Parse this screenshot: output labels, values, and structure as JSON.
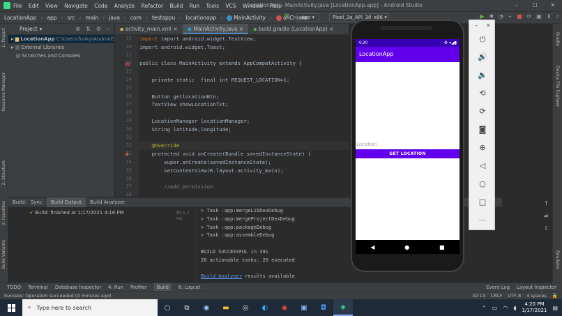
{
  "window": {
    "menu": [
      "File",
      "Edit",
      "View",
      "Navigate",
      "Code",
      "Analyze",
      "Refactor",
      "Build",
      "Run",
      "Tools",
      "VCS",
      "Window",
      "Help"
    ],
    "title": "LocationApp - MainActivity.java [LocationApp.app] - Android Studio"
  },
  "nav": {
    "crumbs": [
      "LocationApp",
      "app",
      "src",
      "main",
      "java",
      "com",
      "testappu",
      "locationapp",
      "MainActivity",
      "onCreate"
    ],
    "run_config": "app",
    "device": "Pixel_3a_API_30_x86"
  },
  "project": {
    "header": "Project",
    "tree": [
      {
        "label": "LocationApp",
        "path": "C:\\Users\\funky\\AndroidS"
      },
      {
        "label": "External Libraries",
        "path": ""
      },
      {
        "label": "Scratches and Consoles",
        "path": ""
      }
    ]
  },
  "left_stripe": {
    "project": "1: Project",
    "resource": "Resource Manager",
    "structure": "2: Structure",
    "favorites": "2: Favorites",
    "variants": "Build Variants"
  },
  "right_stripe": {
    "gradle": "Gradle",
    "explorer": "Device File Explorer",
    "emulator": "Emulator"
  },
  "editor": {
    "tabs": [
      "activity_main.xml",
      "MainActivity.java",
      "build.gradle (LocationApp)"
    ],
    "line_numbers": [
      "19",
      "20",
      "21",
      "22",
      "23",
      "24",
      "25",
      "26",
      "27",
      "28",
      "29",
      "30",
      "31",
      "32",
      "33",
      "34",
      "35",
      "36",
      "37",
      "38"
    ],
    "lines": [
      "import android.widget.TextView;",
      "import android.widget.Toast;",
      "",
      "public class MainActivity extends AppCompatActivity {",
      "",
      "    private static  final int REQUEST_LOCATION=1;",
      "",
      "    Button getlocationBtn;",
      "    TextView showLocationTxt;",
      "",
      "    LocationManager locationManager;",
      "    String latitude,longitude;",
      "",
      "    @Override",
      "    protected void onCreate(Bundle savedInstanceState) {",
      "        super.onCreate(savedInstanceState);",
      "        setContentView(R.layout.activity_main);",
      "",
      "        //Add permission",
      ""
    ]
  },
  "build": {
    "header_tabs": [
      "Build:",
      "Sync",
      "Build Output",
      "Build Analyzer"
    ],
    "tree_row": "Build: finished at 1/17/2021 4:16 PM",
    "tree_time": "40 s 7 ms",
    "output": [
      "> Task :app:mergeLibDexDebug",
      "> Task :app:mergeProjectDexDebug",
      "> Task :app:packageDebug",
      "> Task :app:assembleDebug",
      "",
      "BUILD SUCCESSFUL in 39s",
      "26 actionable tasks: 26 executed",
      ""
    ],
    "analyzer_link": "Build Analyzer",
    "analyzer_suffix": " results available"
  },
  "toolwindows": {
    "left": [
      "TODO",
      "Terminal",
      "Database Inspector",
      "4: Run",
      "Profiler",
      "Build",
      "6: Logcat"
    ],
    "right": [
      "Event Log",
      "Layout Inspector"
    ]
  },
  "statusbar": {
    "message": "Success: Operation succeeded (4 minutes ago)",
    "right": [
      "32:14",
      "CRLF",
      "UTF-8",
      "4 spaces"
    ]
  },
  "phone": {
    "time": "4:20",
    "app_title": "LocationApp",
    "location_label": "Location",
    "button_label": "GET LOCATION"
  },
  "taskbar": {
    "search_placeholder": "Type here to search",
    "time": "4:20 PM",
    "date": "1/17/2021"
  }
}
